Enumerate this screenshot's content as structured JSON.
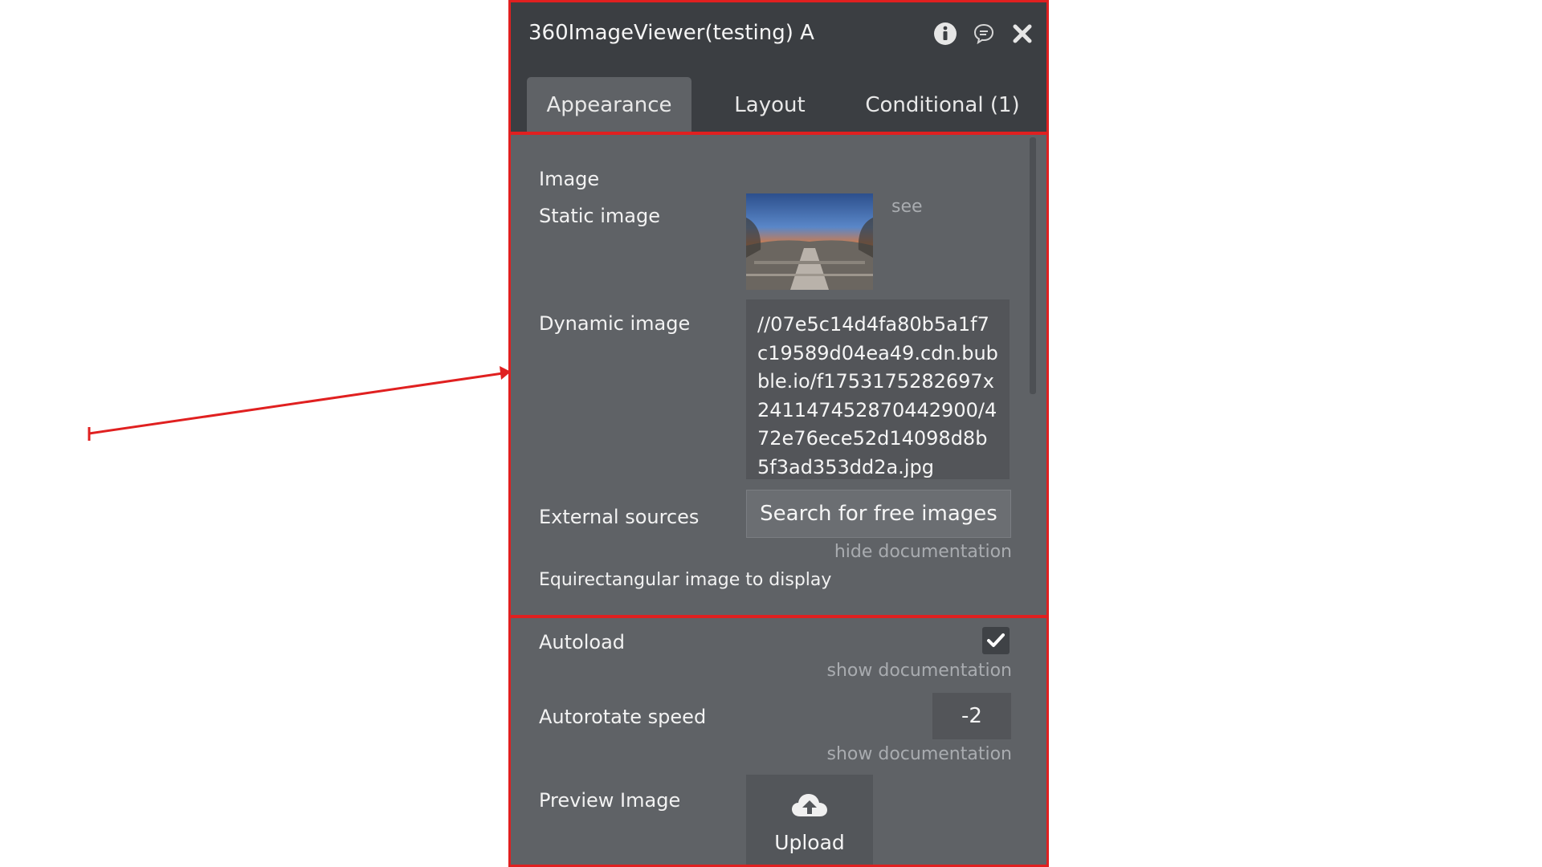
{
  "panel": {
    "title": "360ImageViewer(testing) A",
    "title_icons": [
      "info-icon",
      "comment-icon",
      "close-icon"
    ],
    "tabs": [
      {
        "label": "Appearance",
        "active": true
      },
      {
        "label": "Layout",
        "active": false
      },
      {
        "label": "Conditional (1)",
        "active": false
      }
    ]
  },
  "fields": {
    "section_label": "Image",
    "static_image": {
      "label": "Static image",
      "see_link": "see"
    },
    "dynamic_image": {
      "label": "Dynamic image",
      "value": "//07e5c14d4fa80b5a1f7c19589d04ea49.cdn.bubble.io/f1753175282697x241147452870442900/472e76ece52d14098d8b5f3ad353dd2a.jpg"
    },
    "external_sources": {
      "label": "External sources",
      "button": "Search for free images",
      "doc_link": "hide documentation"
    },
    "description": "Equirectangular image to display",
    "autoload": {
      "label": "Autoload",
      "checked": true,
      "doc_link": "show documentation"
    },
    "autorotate": {
      "label": "Autorotate speed",
      "value": "-2",
      "doc_link": "show documentation"
    },
    "preview": {
      "label": "Preview Image",
      "upload_label": "Upload"
    }
  },
  "colors": {
    "annotation_red": "#e02020",
    "panel_bg": "#5f6266",
    "header_bg": "#3b3e42"
  }
}
